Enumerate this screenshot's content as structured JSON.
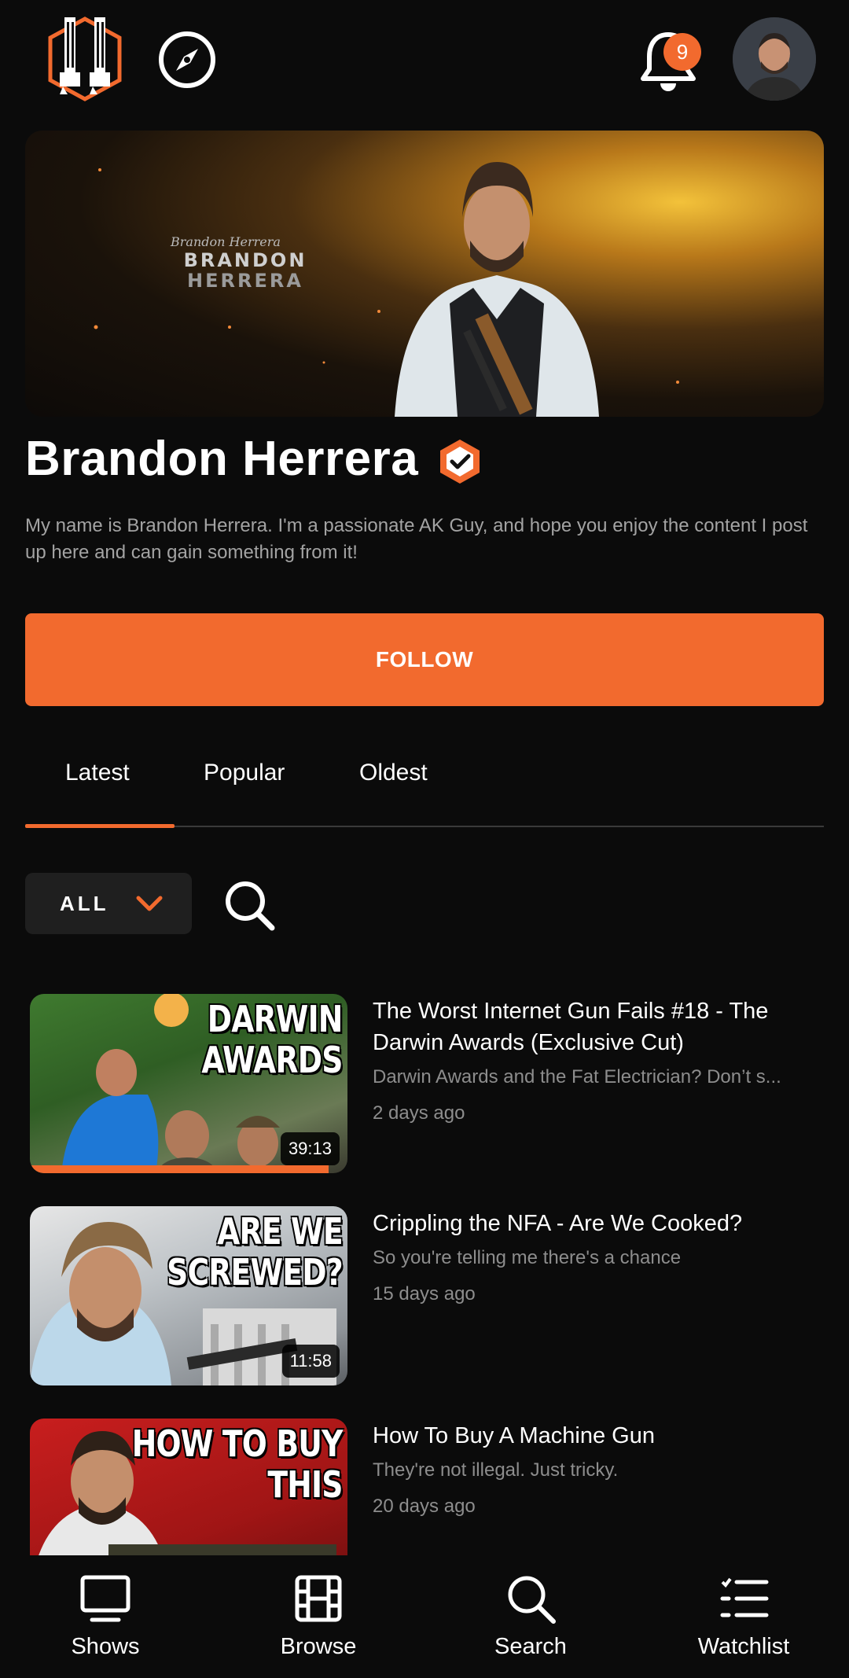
{
  "header": {
    "notification_count": "9"
  },
  "banner": {
    "name_line1": "BRANDON",
    "name_line2": "HERRERA",
    "signature": "Brandon Herrera"
  },
  "channel": {
    "title": "Brandon Herrera",
    "description": "My name is Brandon Herrera. I'm a passionate AK Guy, and hope you enjoy the content I post up here and can gain something from it!",
    "follow_label": "FOLLOW"
  },
  "tabs": [
    {
      "label": "Latest",
      "active": true
    },
    {
      "label": "Popular",
      "active": false
    },
    {
      "label": "Oldest",
      "active": false
    }
  ],
  "filter": {
    "selected": "ALL"
  },
  "videos": [
    {
      "thumb_text": [
        "DARWIN",
        "AWARDS"
      ],
      "title": "The Worst Internet Gun Fails #18 - The Darwin Awards (Exclusive Cut)",
      "subtitle": "Darwin Awards and the Fat Electrician? Don’t s...",
      "age": "2 days ago",
      "duration": "39:13",
      "watched_fraction": 0.94
    },
    {
      "thumb_text": [
        "ARE WE",
        "SCREWED?"
      ],
      "title": "Crippling the NFA - Are We Cooked?",
      "subtitle": "So you're telling me there's a chance",
      "age": "15 days ago",
      "duration": "11:58"
    },
    {
      "thumb_text": [
        "HOW TO BUY",
        "THIS"
      ],
      "title": "How To Buy A Machine Gun",
      "subtitle": "They're not illegal. Just tricky.",
      "age": "20 days ago",
      "duration": ""
    }
  ],
  "bottom_nav": [
    {
      "label": "Shows",
      "icon": "tv-icon"
    },
    {
      "label": "Browse",
      "icon": "film-icon"
    },
    {
      "label": "Search",
      "icon": "search-icon"
    },
    {
      "label": "Watchlist",
      "icon": "list-icon"
    }
  ],
  "colors": {
    "accent": "#f26a2e",
    "background": "#0b0b0b"
  }
}
